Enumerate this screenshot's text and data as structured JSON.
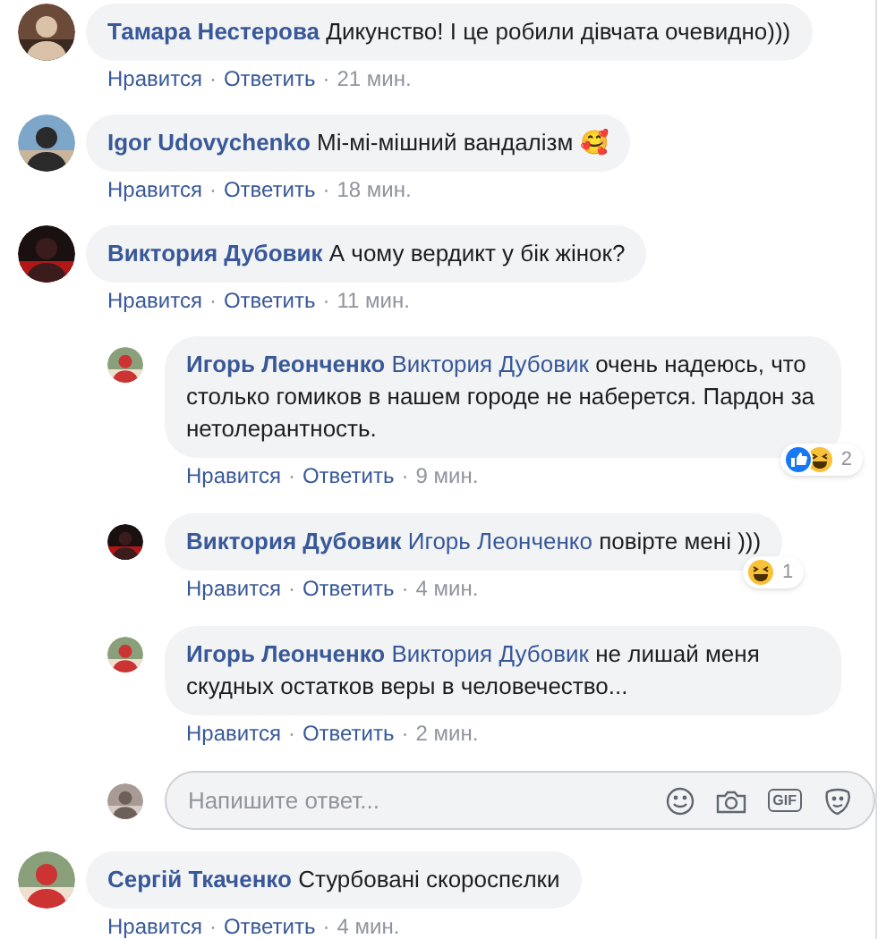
{
  "comments": [
    {
      "author": "Тамара Нестерова",
      "text": "Дикунство! І це робили дівчата очевидно)))",
      "like": "Нравится",
      "sep": "·",
      "reply": "Ответить",
      "time": "21 мин."
    },
    {
      "author": "Igor Udovychenko",
      "text": "Мі-мі-мішний вандалізм 🥰",
      "like": "Нравится",
      "sep": "·",
      "reply": "Ответить",
      "time": "18 мин."
    },
    {
      "author": "Виктория Дубовик",
      "text": "А чому вердикт у бік жінок?",
      "like": "Нравится",
      "sep": "·",
      "reply": "Ответить",
      "time": "11 мин.",
      "replies": [
        {
          "author": "Игорь Леонченко",
          "mention": "Виктория Дубовик",
          "text": "очень надеюсь, что столько гомиков в нашем городе не наберется. Пардон за нетолерантность.",
          "like": "Нравится",
          "sep": "·",
          "reply": "Ответить",
          "time": "9 мин.",
          "reactions": [
            {
              "kind": "like"
            },
            {
              "kind": "haha"
            }
          ],
          "reaction_count": "2"
        },
        {
          "author": "Виктория Дубовик",
          "mention": "Игорь Леонченко",
          "text": "повірте мені )))",
          "like": "Нравится",
          "sep": "·",
          "reply": "Ответить",
          "time": "4 мин.",
          "reactions": [
            {
              "kind": "haha"
            }
          ],
          "reaction_count": "1"
        },
        {
          "author": "Игорь Леонченко",
          "mention": "Виктория Дубовик",
          "text": "не лишай меня скудных остатков веры в человечество...",
          "like": "Нравится",
          "sep": "·",
          "reply": "Ответить",
          "time": "2 мин."
        }
      ],
      "reply_box": {
        "placeholder": "Напишите ответ...",
        "gif_label": "GIF"
      }
    },
    {
      "author": "Сергій Ткаченко",
      "text": "Стурбовані скороспєлки",
      "like": "Нравится",
      "sep": "·",
      "reply": "Ответить",
      "time": "4 мин."
    }
  ]
}
